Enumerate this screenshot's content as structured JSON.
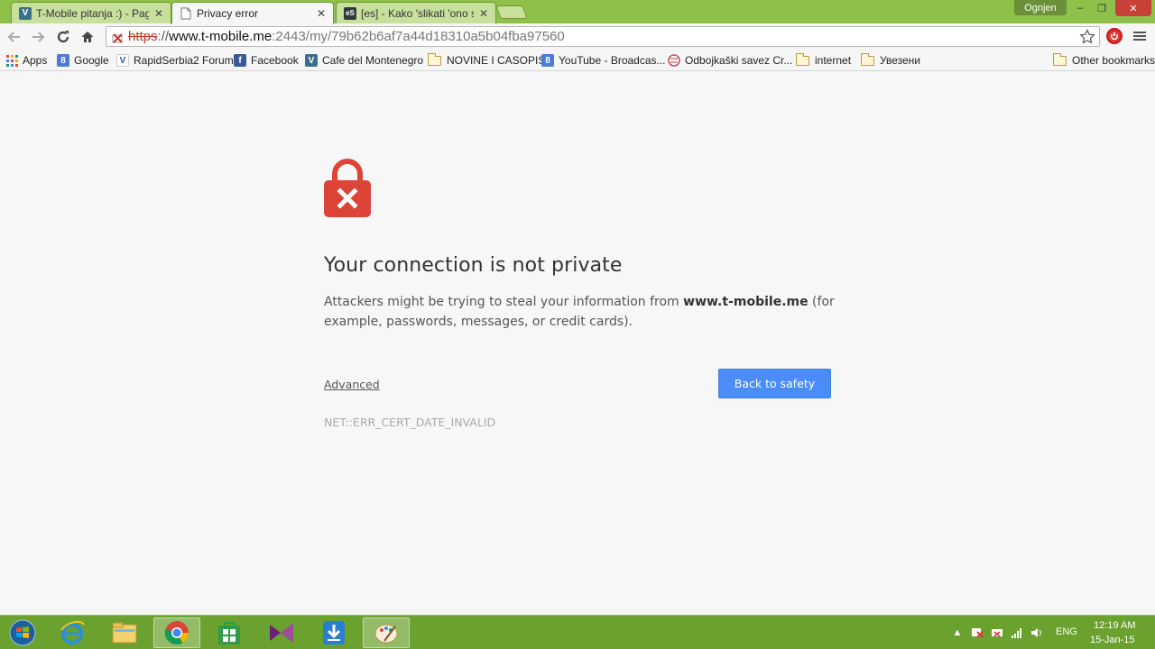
{
  "tabs": [
    {
      "title": "T-Mobile pitanja :) - Page",
      "close": "✕",
      "favicon_text": "V"
    },
    {
      "title": "Privacy error",
      "close": "✕"
    },
    {
      "title": "[es] - Kako 'slikati 'ono sto",
      "close": "✕",
      "favicon_text": "eS"
    }
  ],
  "window": {
    "user": "Ognjen",
    "minimize": "–",
    "restore": "❐",
    "close": "✕"
  },
  "omnibox": {
    "scheme": "https",
    "separator": "://",
    "host": "www.t-mobile.me",
    "path": ":2443/my/79b62b6af7a44d18310a5b04fba97560"
  },
  "bookmarks": [
    {
      "label": "Apps",
      "icon": "apps-grid-icon"
    },
    {
      "label": "Google",
      "icon": "google-icon",
      "icon_text": "8"
    },
    {
      "label": "RapidSerbia2 Forum",
      "icon": "rapidserbia-icon",
      "icon_text": "V"
    },
    {
      "label": "Facebook",
      "icon": "facebook-icon",
      "icon_text": "f"
    },
    {
      "label": "Cafe del Montenegro",
      "icon": "cafe-icon",
      "icon_text": "V"
    },
    {
      "label": "NOVINE I CASOPISI",
      "icon": "folder-icon"
    },
    {
      "label": "YouTube - Broadcas...",
      "icon": "youtube-icon",
      "icon_text": "8"
    },
    {
      "label": "Odbojkaški savez Cr...",
      "icon": "volleyball-icon"
    },
    {
      "label": "internet",
      "icon": "folder-icon"
    },
    {
      "label": "Увезени",
      "icon": "folder-icon"
    },
    {
      "label": "Other bookmarks",
      "icon": "folder-icon"
    }
  ],
  "error": {
    "title": "Your connection is not private",
    "desc_before": "Attackers might be trying to steal your information from ",
    "desc_host": "www.t-mobile.me",
    "desc_after": " (for example, passwords, messages, or credit cards).",
    "advanced": "Advanced",
    "back_button": "Back to safety",
    "code": "NET::ERR_CERT_DATE_INVALID"
  },
  "taskbar": {
    "lang": "ENG",
    "time": "12:19 AM",
    "date": "15-Jan-15"
  },
  "colors": {
    "tab_strip": "#8fc04a",
    "taskbar": "#6aa12f",
    "lock_red": "#db4437",
    "button_blue": "#4b8df8"
  }
}
